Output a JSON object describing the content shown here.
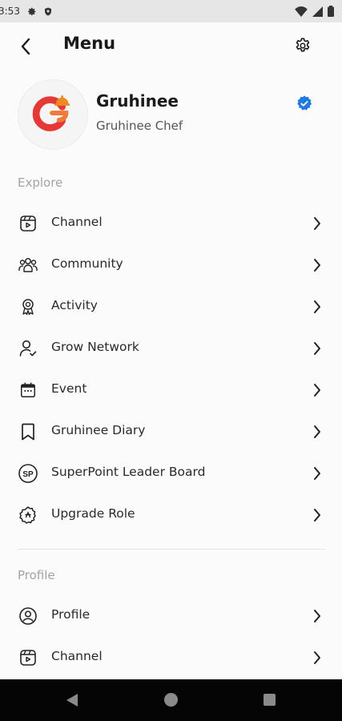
{
  "status_bar": {
    "time": "3:53"
  },
  "header": {
    "title": "Menu"
  },
  "profile": {
    "name": "Gruhinee",
    "role": "Gruhinee Chef"
  },
  "colors": {
    "accent": "#1f7ae0",
    "brand_red": "#e53935",
    "brand_orange": "#f08a24"
  },
  "explore": {
    "title": "Explore",
    "items": [
      {
        "label": "Channel",
        "icon": "channel-icon"
      },
      {
        "label": "Community",
        "icon": "community-icon"
      },
      {
        "label": "Activity",
        "icon": "award-icon"
      },
      {
        "label": "Grow Network",
        "icon": "user-check-icon"
      },
      {
        "label": "Event",
        "icon": "calendar-icon"
      },
      {
        "label": "Gruhinee Diary",
        "icon": "bookmark-icon"
      },
      {
        "label": "SuperPoint Leader Board",
        "icon": "superpoint-icon"
      },
      {
        "label": "Upgrade Role",
        "icon": "upgrade-icon"
      }
    ]
  },
  "profile_section": {
    "title": "Profile",
    "items": [
      {
        "label": "Profile",
        "icon": "user-circle-icon"
      },
      {
        "label": "Channel",
        "icon": "channel-icon"
      }
    ]
  }
}
